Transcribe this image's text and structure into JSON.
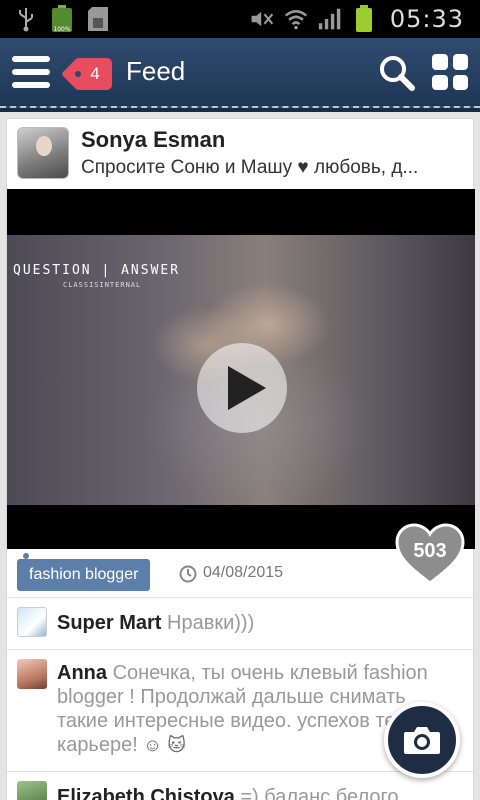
{
  "status_bar": {
    "time": "05:33",
    "battery_label": "100%",
    "icons": [
      "usb-icon",
      "battery-full-icon",
      "sd-card-icon",
      "mute-icon",
      "wifi-icon",
      "signal-icon",
      "battery-charging-icon"
    ]
  },
  "app_bar": {
    "title": "Feed",
    "notification_count": "4",
    "icons": [
      "menu-icon",
      "notification-tag-icon",
      "search-icon",
      "grid-view-icon"
    ]
  },
  "post": {
    "author": "Sonya Esman",
    "description": "Спросите Соню и Машу ♥ любовь, д...",
    "video": {
      "overlay_title": "QUESTION | ANSWER",
      "overlay_subtitle": "CLASSISINTERNAL",
      "play_icon": "play-icon"
    },
    "likes": "503",
    "tag": "fashion blogger",
    "date": "04/08/2015"
  },
  "comments": [
    {
      "author": "Super Mart",
      "text": "Нравки)))"
    },
    {
      "author": "Anna",
      "text": "Сонечка, ты очень клевый fashion blogger ! Продолжай дальше снимать такие интересные видео. успехов тебе в карьере!"
    },
    {
      "author": "Elizabeth Chistova",
      "text": "=) баланс белого"
    }
  ],
  "fab": {
    "icon": "camera-icon"
  },
  "colors": {
    "app_bar": "#253f60",
    "badge": "#e84c5f",
    "tag": "#5b7fa8",
    "fab": "#1e2c44"
  }
}
